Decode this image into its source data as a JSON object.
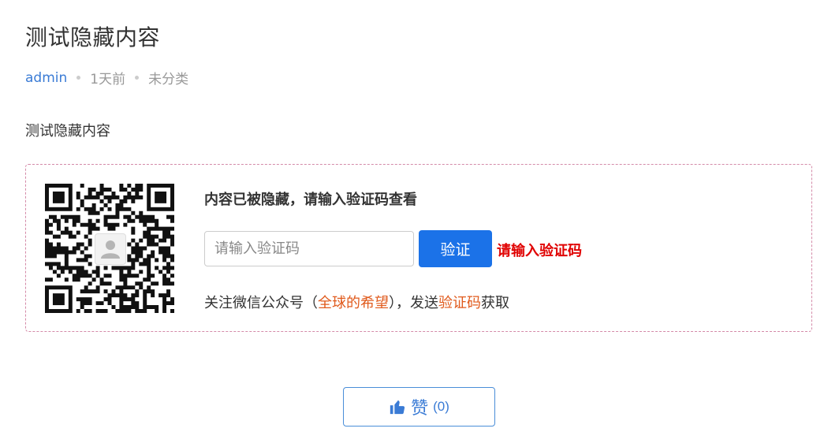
{
  "post": {
    "title": "测试隐藏内容",
    "author": "admin",
    "time": "1天前",
    "category": "未分类",
    "body": "测试隐藏内容"
  },
  "hidden": {
    "prompt": "内容已被隐藏，请输入验证码查看",
    "input_placeholder": "请输入验证码",
    "input_value": "",
    "verify_label": "验证",
    "error_text": "请输入验证码",
    "hint_prefix": "关注微信公众号（",
    "hint_account": "全球的希望",
    "hint_middle": "），发送",
    "hint_code": "验证码",
    "hint_suffix": "获取"
  },
  "like": {
    "label": "赞",
    "count": "(0)"
  },
  "colors": {
    "accent": "#1b72e8",
    "link": "#3a7bd5",
    "error": "#e00000",
    "highlight": "#e05a1c",
    "dashed_border": "#d48aa8"
  },
  "icons": {
    "qr": "wechat-qr-code-icon",
    "thumb": "thumbs-up-icon"
  }
}
